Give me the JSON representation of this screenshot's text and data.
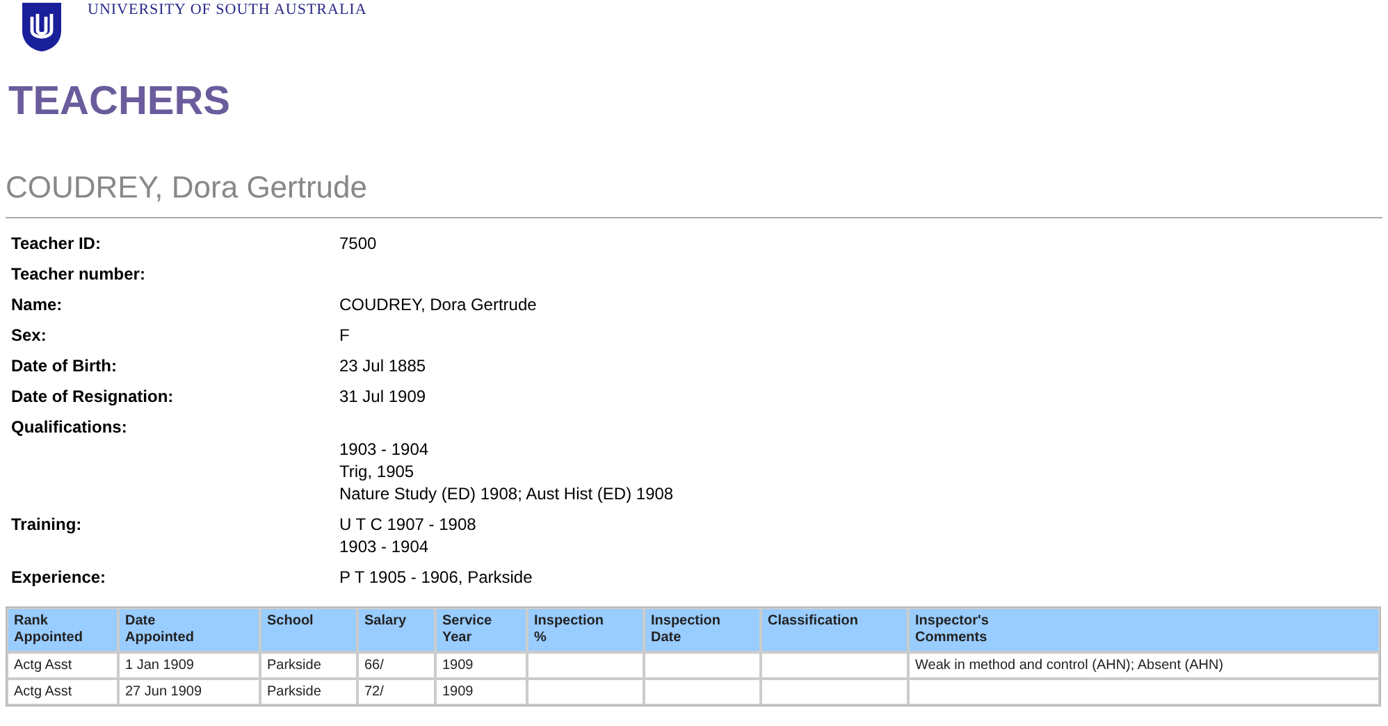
{
  "header": {
    "university": "UNIVERSITY OF SOUTH AUSTRALIA"
  },
  "page_title": "TEACHERS",
  "record_title": "COUDREY, Dora Gertrude",
  "fields": [
    {
      "label": "Teacher ID:",
      "lines": [
        "7500"
      ]
    },
    {
      "label": "Teacher number:"
    },
    {
      "label": "Name:",
      "lines": [
        "COUDREY, Dora Gertrude"
      ]
    },
    {
      "label": "Sex:",
      "lines": [
        "F"
      ]
    },
    {
      "label": "Date of Birth:",
      "lines": [
        "23 Jul 1885"
      ]
    },
    {
      "label": "Date of Resignation:",
      "lines": [
        "31 Jul 1909"
      ]
    },
    {
      "label": "Qualifications:",
      "leading_blank": true,
      "lines": [
        "1903 - 1904",
        "Trig, 1905",
        "Nature Study (ED) 1908; Aust Hist (ED) 1908"
      ]
    },
    {
      "label": "Training:",
      "lines": [
        "U T C 1907 - 1908",
        "1903 - 1904"
      ]
    },
    {
      "label": "Experience:",
      "lines": [
        "P T 1905 - 1906, Parkside"
      ]
    }
  ],
  "table": {
    "columns": [
      "Rank\nAppointed",
      "Date\nAppointed",
      "School",
      "Salary",
      "Service\nYear",
      "Inspection\n%",
      "Inspection\nDate",
      "Classification",
      "Inspector's\nComments"
    ],
    "rows": [
      [
        "Actg Asst",
        "1 Jan 1909",
        "Parkside",
        "66/",
        "1909",
        "",
        "",
        "",
        "Weak in method and control (AHN); Absent (AHN)"
      ],
      [
        "Actg Asst",
        "27 Jun 1909",
        "Parkside",
        "72/",
        "1909",
        "",
        "",
        "",
        ""
      ]
    ]
  }
}
